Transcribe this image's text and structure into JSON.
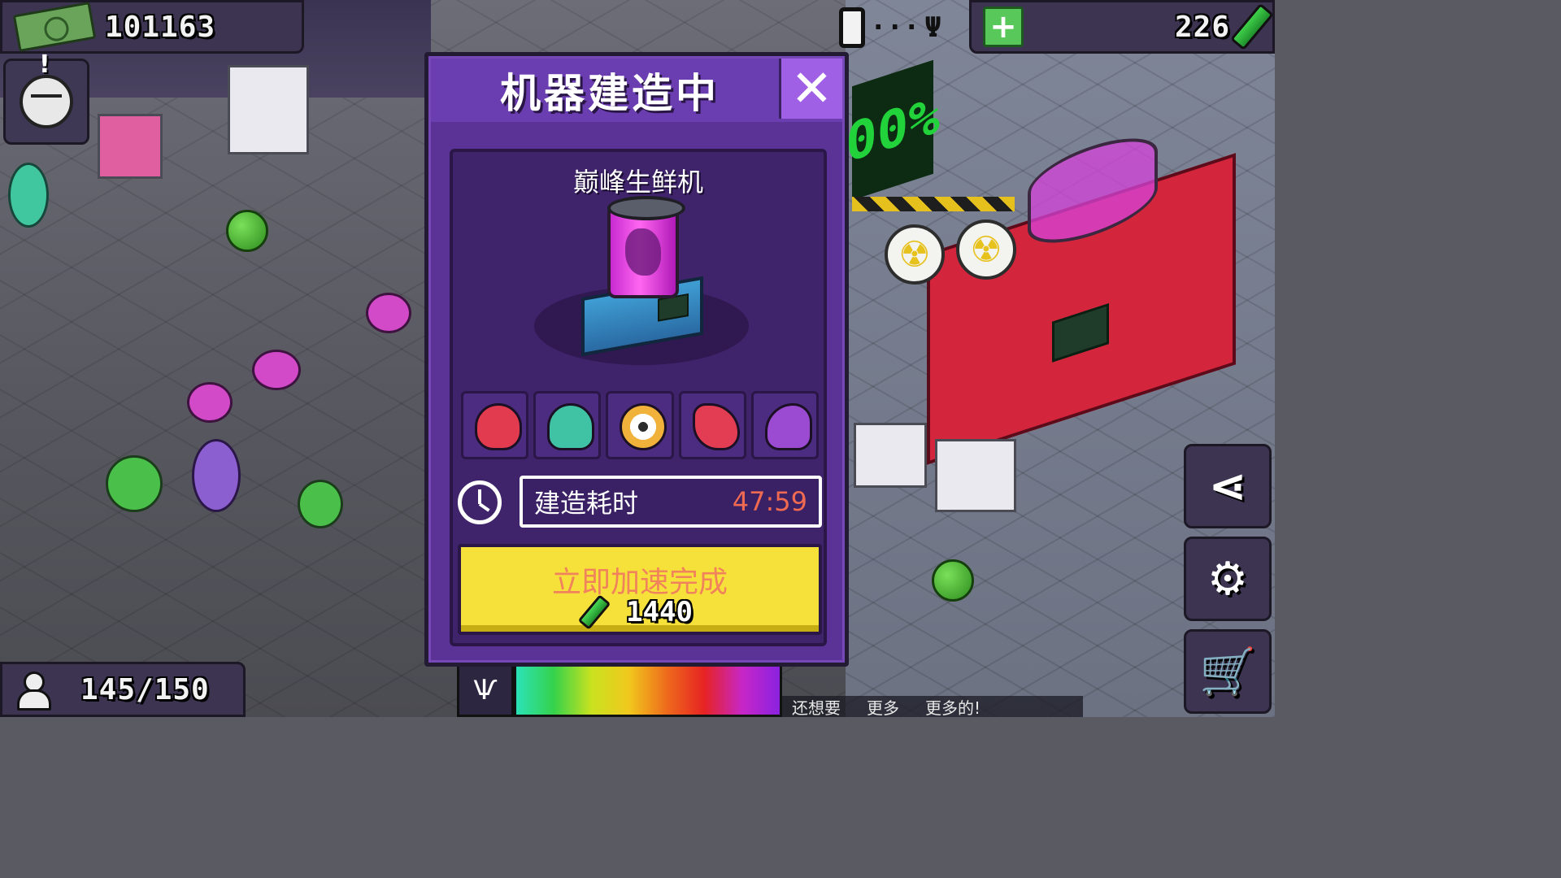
{
  "hud": {
    "money": "101163",
    "energy": "226",
    "population": "145/150"
  },
  "dialog": {
    "title": "机器建造中",
    "close_symbol": "✕",
    "machine_name": "巅峰生鲜机",
    "ingredients": [
      {
        "name": "red-flower-ingredient",
        "color": "#e23a4f"
      },
      {
        "name": "green-octopus-ingredient",
        "color": "#3fc3a4"
      },
      {
        "name": "eyeball-ingredient",
        "color": "#f0b23a"
      },
      {
        "name": "red-crab-ingredient",
        "color": "#e33d53"
      },
      {
        "name": "purple-worm-ingredient",
        "color": "#9a4bd1"
      }
    ],
    "build_time_label": "建造耗时",
    "build_time_value": "47:59",
    "speedup_label": "立即加速完成",
    "speedup_cost": "1440"
  },
  "ticker": {
    "items": [
      "还想要",
      "更多",
      "更多的!"
    ]
  },
  "colors": {
    "dialog_bg": "#5b3396",
    "speedup_button": "#f6e13a",
    "time_value": "#f06a52"
  },
  "icons": {
    "share": "share-icon",
    "settings": "gear-icon",
    "shop": "cart-icon"
  }
}
